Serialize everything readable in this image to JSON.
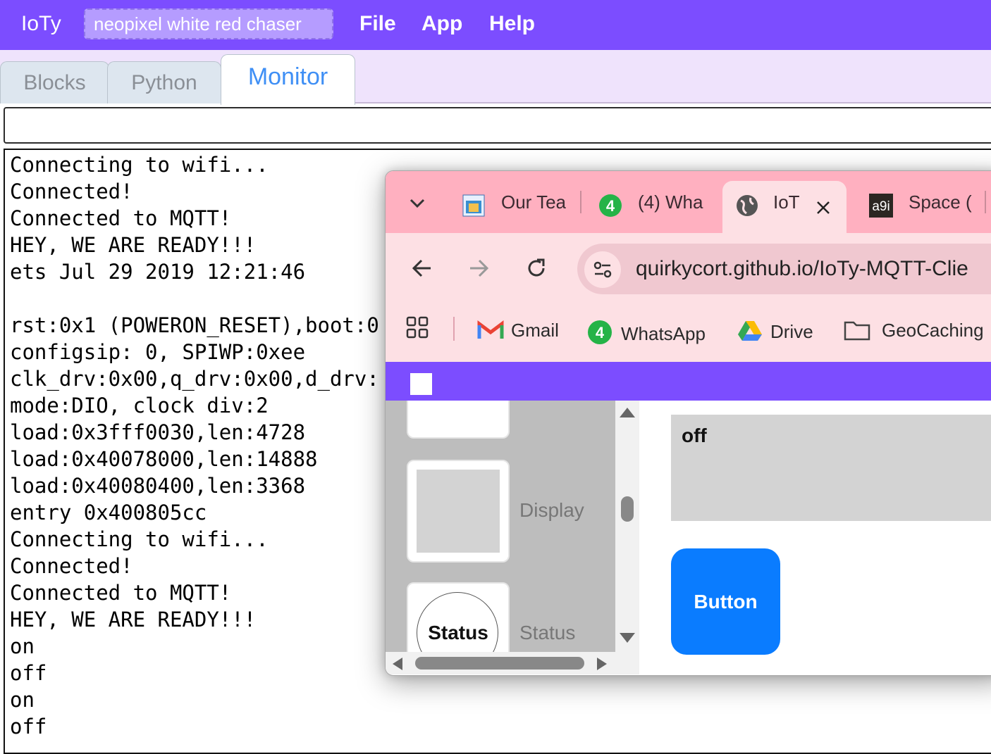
{
  "app": {
    "brand": "IoTy",
    "project_name": "neopixel white red chaser",
    "menu": [
      "File",
      "App",
      "Help"
    ],
    "accent_color": "#7c4dff"
  },
  "tabs": [
    {
      "label": "Blocks",
      "active": false
    },
    {
      "label": "Python",
      "active": false
    },
    {
      "label": "Monitor",
      "active": true
    }
  ],
  "console": {
    "lines": [
      "Connecting to wifi...",
      "Connected!",
      "Connected to MQTT!",
      "HEY, WE ARE READY!!!",
      "ets Jul 29 2019 12:21:46",
      "",
      "rst:0x1 (POWERON_RESET),boot:0",
      "configsip: 0, SPIWP:0xee",
      "clk_drv:0x00,q_drv:0x00,d_drv:",
      "mode:DIO, clock div:2",
      "load:0x3fff0030,len:4728",
      "load:0x40078000,len:14888",
      "load:0x40080400,len:3368",
      "entry 0x400805cc",
      "Connecting to wifi...",
      "Connected!",
      "Connected to MQTT!",
      "HEY, WE ARE READY!!!",
      "on",
      "off",
      "on",
      "off"
    ]
  },
  "browser": {
    "tabs": [
      {
        "label": "Our Tea",
        "icon": "icpc-favicon"
      },
      {
        "label": "(4) Wha",
        "icon": "whatsapp-favicon",
        "badge": "4"
      },
      {
        "label": "IoT",
        "icon": "globe-icon",
        "active": true
      },
      {
        "label": "Space (",
        "icon": "a9i-favicon",
        "badge": "a9i"
      }
    ],
    "url": "quirkycort.github.io/IoTy-MQTT-Clie",
    "bookmarks": [
      {
        "label": "Gmail",
        "icon": "gmail-icon"
      },
      {
        "label": "WhatsApp",
        "icon": "whatsapp-icon",
        "badge": "4"
      },
      {
        "label": "Drive",
        "icon": "drive-icon"
      },
      {
        "label": "GeoCaching",
        "icon": "folder-icon"
      }
    ],
    "tab_strip_color": "#ffb0c0",
    "toolbar_color": "#fde0e4"
  },
  "mqtt_app": {
    "palette": [
      {
        "label": "Display"
      },
      {
        "label": "Status",
        "card_text": "Status"
      }
    ],
    "display_value": "off",
    "button_label": "Button",
    "button_color": "#0a7cff"
  }
}
